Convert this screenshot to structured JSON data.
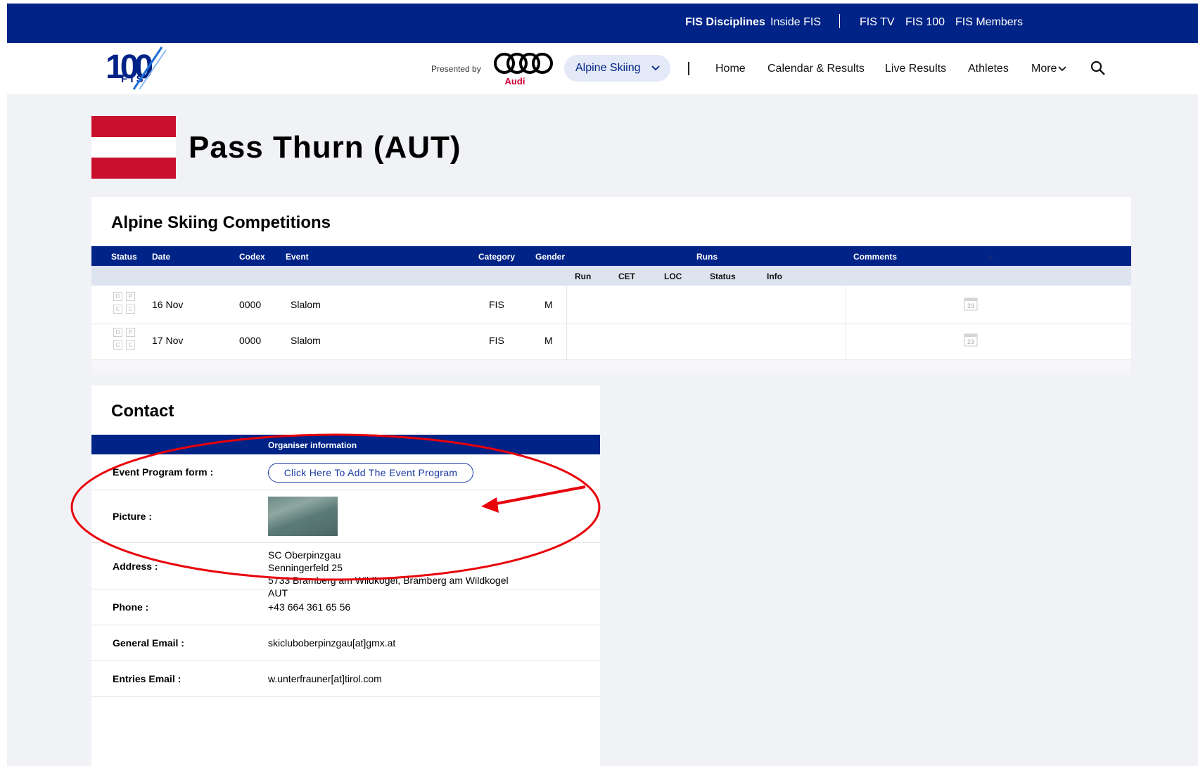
{
  "topbar": {
    "links": [
      "FIS Disciplines",
      "Inside FIS",
      "FIS TV",
      "FIS 100",
      "FIS Members"
    ]
  },
  "header": {
    "logo_text": "100 FIS",
    "presented_by": "Presented by",
    "sponsor": "Audi",
    "discipline": "Alpine Skiing",
    "nav": [
      "Home",
      "Calendar & Results",
      "Live Results",
      "Athletes",
      "More"
    ]
  },
  "page": {
    "title": "Pass Thurn (AUT)",
    "flag_colors": [
      "#c8102e",
      "#ffffff",
      "#c8102e"
    ]
  },
  "competitions": {
    "title": "Alpine Skiing Competitions",
    "columns": {
      "status": "Status",
      "date": "Date",
      "codex": "Codex",
      "event": "Event",
      "category": "Category",
      "gender": "Gender",
      "runs": "Runs",
      "comments": "Comments"
    },
    "run_columns": [
      "Run",
      "CET",
      "LOC",
      "Status",
      "Info"
    ],
    "status_letters": [
      "D",
      "P",
      "C",
      "C"
    ],
    "calendar_icon_text": "23",
    "rows": [
      {
        "date": "16 Nov",
        "codex": "0000",
        "event": "Slalom",
        "category": "FIS",
        "gender": "M"
      },
      {
        "date": "17 Nov",
        "codex": "0000",
        "event": "Slalom",
        "category": "FIS",
        "gender": "M"
      }
    ]
  },
  "contact": {
    "title": "Contact",
    "header": "Organiser information",
    "event_program_label": "Event Program form :",
    "event_program_button": "Click Here To Add The Event Program",
    "picture_label": "Picture :",
    "address_label": "Address :",
    "address_lines": [
      "SC Oberpinzgau",
      "Senningerfeld 25",
      "5733 Bramberg am Wildkogel, Bramberg am Wildkogel",
      "AUT"
    ],
    "phone_label": "Phone :",
    "phone": "+43 664 361 65 56",
    "general_email_label": "General Email :",
    "general_email": "skicluboberpinzgau[at]gmx.at",
    "entries_email_label": "Entries Email :",
    "entries_email": "w.unterfrauner[at]tirol.com"
  },
  "annotation": {
    "color": "#e8000b"
  }
}
